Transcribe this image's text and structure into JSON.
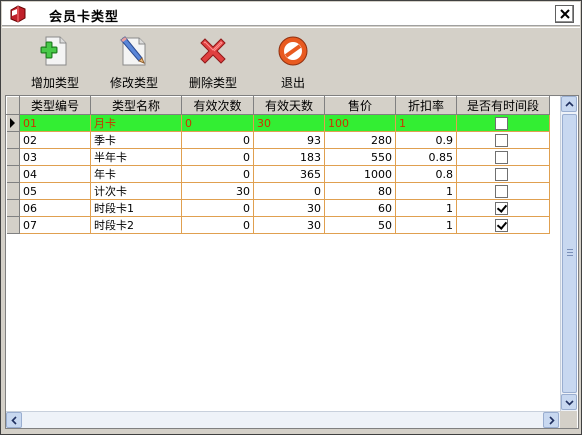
{
  "window": {
    "title": "会员卡类型"
  },
  "toolbar": {
    "add_label": "增加类型",
    "edit_label": "修改类型",
    "delete_label": "删除类型",
    "exit_label": "退出"
  },
  "table": {
    "columns": [
      "类型编号",
      "类型名称",
      "有效次数",
      "有效天数",
      "售价",
      "折扣率",
      "是否有时间段"
    ],
    "rows": [
      {
        "code": "01",
        "name": "月卡",
        "times": "0",
        "days": "30",
        "price": "100",
        "discount": "1",
        "timed": false,
        "selected": true
      },
      {
        "code": "02",
        "name": "季卡",
        "times": "0",
        "days": "93",
        "price": "280",
        "discount": "0.9",
        "timed": false,
        "selected": false
      },
      {
        "code": "03",
        "name": "半年卡",
        "times": "0",
        "days": "183",
        "price": "550",
        "discount": "0.85",
        "timed": false,
        "selected": false
      },
      {
        "code": "04",
        "name": "年卡",
        "times": "0",
        "days": "365",
        "price": "1000",
        "discount": "0.8",
        "timed": false,
        "selected": false
      },
      {
        "code": "05",
        "name": "计次卡",
        "times": "30",
        "days": "0",
        "price": "80",
        "discount": "1",
        "timed": false,
        "selected": false
      },
      {
        "code": "06",
        "name": "时段卡1",
        "times": "0",
        "days": "30",
        "price": "60",
        "discount": "1",
        "timed": true,
        "selected": false
      },
      {
        "code": "07",
        "name": "时段卡2",
        "times": "0",
        "days": "30",
        "price": "50",
        "discount": "1",
        "timed": true,
        "selected": false
      }
    ]
  },
  "icons": {
    "app": "card-app-icon",
    "add": "add-document-icon",
    "edit": "edit-pencil-icon",
    "delete": "delete-x-icon",
    "exit": "no-entry-icon",
    "close": "close-icon"
  },
  "colors": {
    "selected_row_bg": "#33ee33",
    "selected_row_text": "#cc3300",
    "grid_line": "#e0a050"
  }
}
